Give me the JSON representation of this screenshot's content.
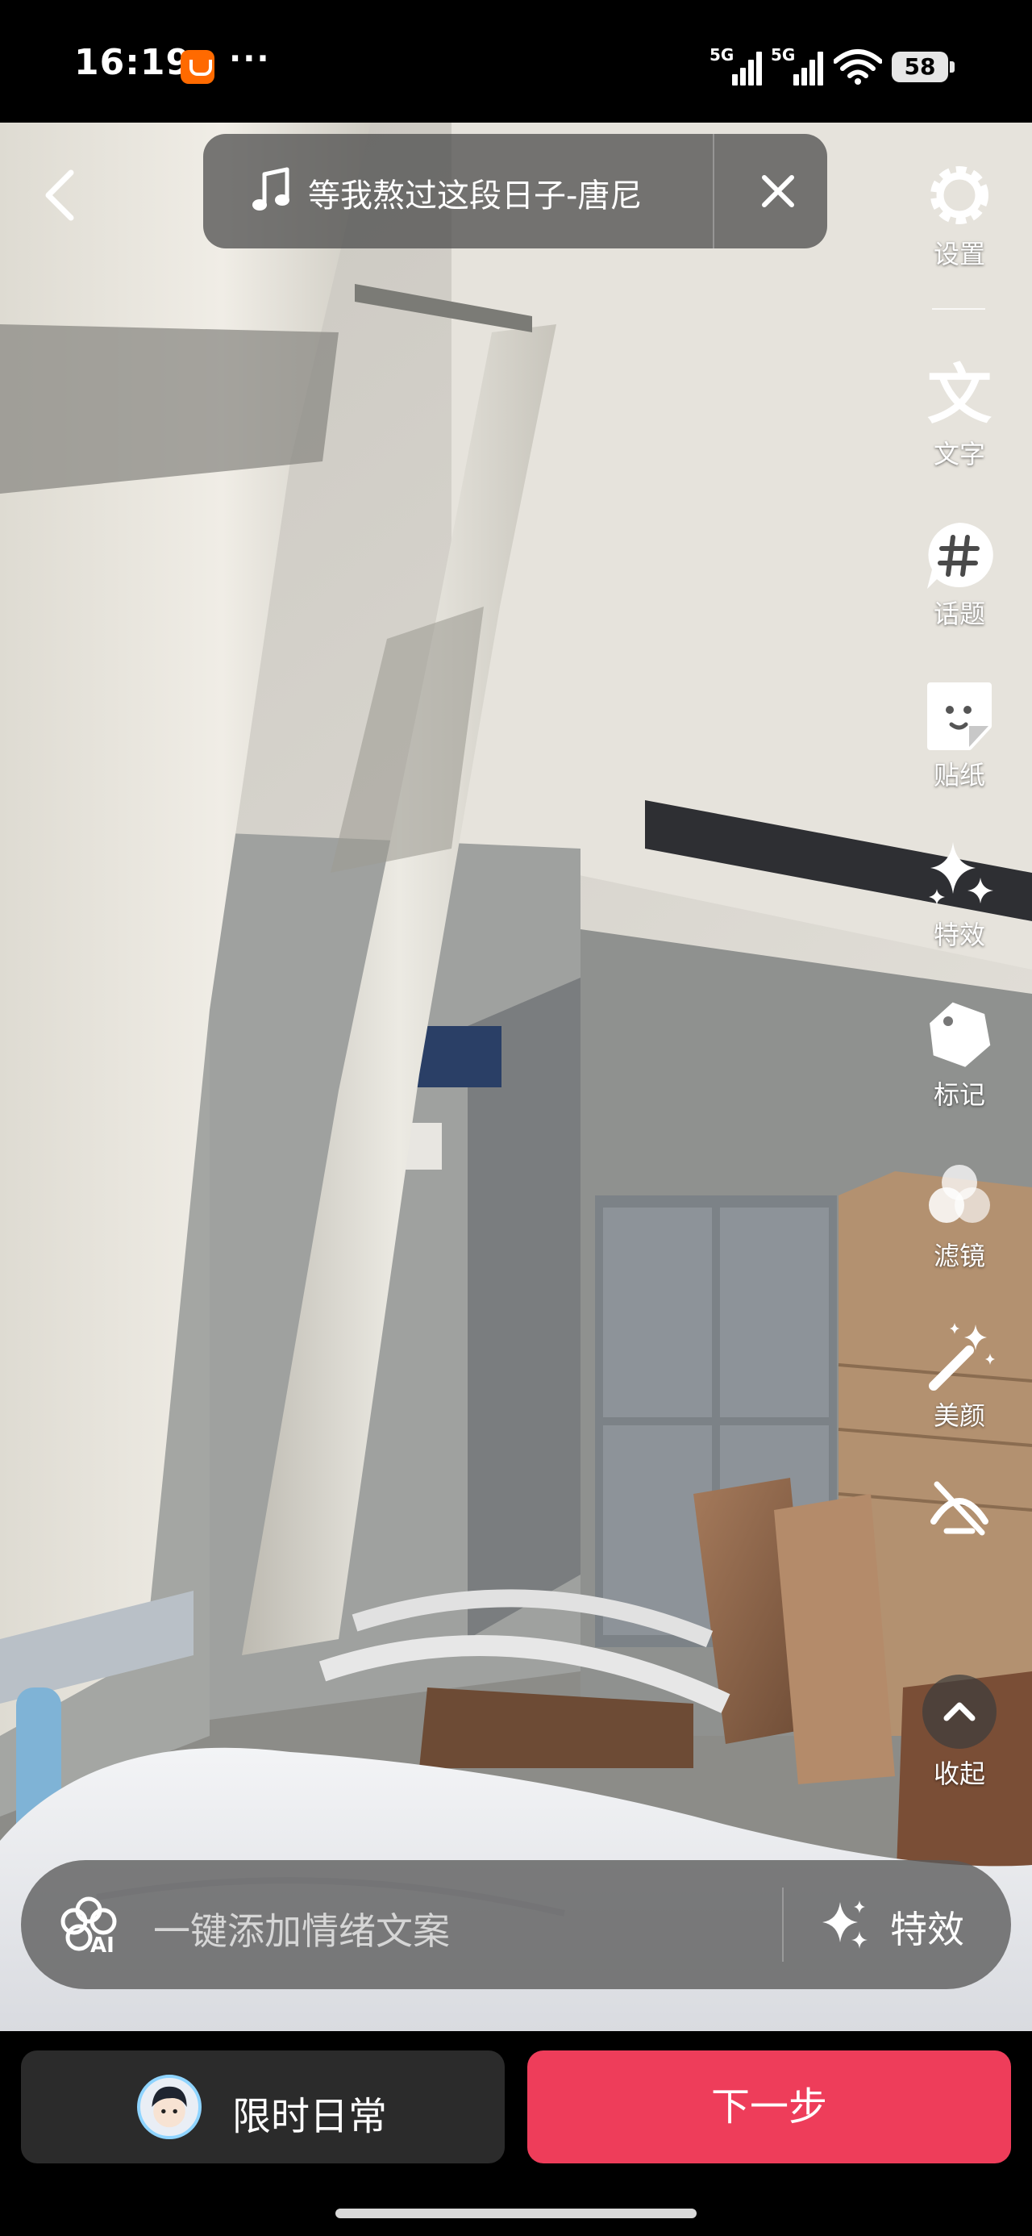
{
  "status_bar": {
    "time": "16:19",
    "app_badge_icon": "taobao-app-icon",
    "more": "···",
    "signal_1_label": "5G",
    "signal_2_label": "5G",
    "battery": "58"
  },
  "top_bar": {
    "back_icon": "back-chevron-icon",
    "music_icon": "music-note-icon",
    "music_title": "等我熬过这段日子-唐尼",
    "close_icon": "close-icon"
  },
  "tools": [
    {
      "id": "settings",
      "icon": "gear-icon",
      "label": "设置"
    },
    {
      "id": "text",
      "icon": "text-icon",
      "label": "文字"
    },
    {
      "id": "topic",
      "icon": "hashtag-icon",
      "label": "话题"
    },
    {
      "id": "sticker",
      "icon": "sticker-icon",
      "label": "贴纸"
    },
    {
      "id": "effects",
      "icon": "sparkle-icon",
      "label": "特效"
    },
    {
      "id": "tag",
      "icon": "tag-icon",
      "label": "标记"
    },
    {
      "id": "filter",
      "icon": "filter-icon",
      "label": "滤镜"
    },
    {
      "id": "beauty",
      "icon": "magic-wand-icon",
      "label": "美颜"
    },
    {
      "id": "collapse",
      "icon": "chevron-up-icon",
      "label": "收起"
    }
  ],
  "caption_bar": {
    "ai_icon": "ai-flower-icon",
    "ai_text": "AI",
    "placeholder": "一键添加情绪文案",
    "fx_icon": "sparkle-icon",
    "fx_label": "特效"
  },
  "bottom": {
    "daily_label": "限时日常",
    "next_label": "下一步"
  },
  "colors": {
    "next_button": "#ee3d5a",
    "daily_button": "#2b2b2b"
  }
}
